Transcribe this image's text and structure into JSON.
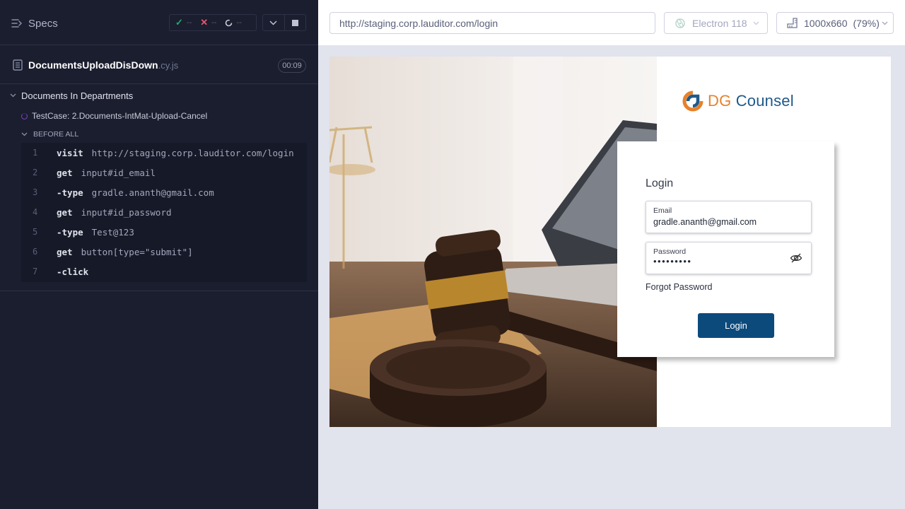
{
  "reporter": {
    "specs_label": "Specs",
    "stats": {
      "passed": "--",
      "failed": "--",
      "pending": "--"
    },
    "spec_file": {
      "name": "DocumentsUploadDisDown",
      "ext": ".cy.js",
      "duration": "00:09"
    },
    "suite_title": "Documents In Departments",
    "test_title": "TestCase: 2.Documents-IntMat-Upload-Cancel",
    "hook_title": "BEFORE ALL",
    "commands": [
      {
        "num": "1",
        "name": "visit",
        "message": "http://staging.corp.lauditor.com/login"
      },
      {
        "num": "2",
        "name": "get",
        "message": "input#id_email"
      },
      {
        "num": "3",
        "name": "-type",
        "message": "gradle.ananth@gmail.com"
      },
      {
        "num": "4",
        "name": "get",
        "message": "input#id_password"
      },
      {
        "num": "5",
        "name": "-type",
        "message": "Test@123"
      },
      {
        "num": "6",
        "name": "get",
        "message": "button[type=\"submit\"]"
      },
      {
        "num": "7",
        "name": "-click",
        "message": ""
      }
    ]
  },
  "runner": {
    "url": "http://staging.corp.lauditor.com/login",
    "browser": "Electron 118",
    "viewport": "1000x660",
    "scale": "(79%)"
  },
  "app": {
    "brand_prefix": "DG",
    "brand_suffix": " Counsel",
    "login_title": "Login",
    "email_label": "Email",
    "email_value": "gradle.ananth@gmail.com",
    "password_label": "Password",
    "password_value": "•••••••••",
    "forgot_password": "Forgot Password",
    "login_button": "Login"
  },
  "colors": {
    "reporter_bg": "#1b1e2e",
    "pass": "#1fa971",
    "fail": "#e45770",
    "brand_blue": "#1f5a8a",
    "brand_orange": "#e7812a",
    "login_button": "#0d4a7c"
  },
  "icons": [
    "specs-list-icon",
    "check-icon",
    "x-icon",
    "pending-icon",
    "chevron-down-icon",
    "stop-icon",
    "file-icon",
    "spinner-icon",
    "browser-icon",
    "ruler-icon",
    "eye-slash-icon",
    "brand-logo-icon"
  ]
}
